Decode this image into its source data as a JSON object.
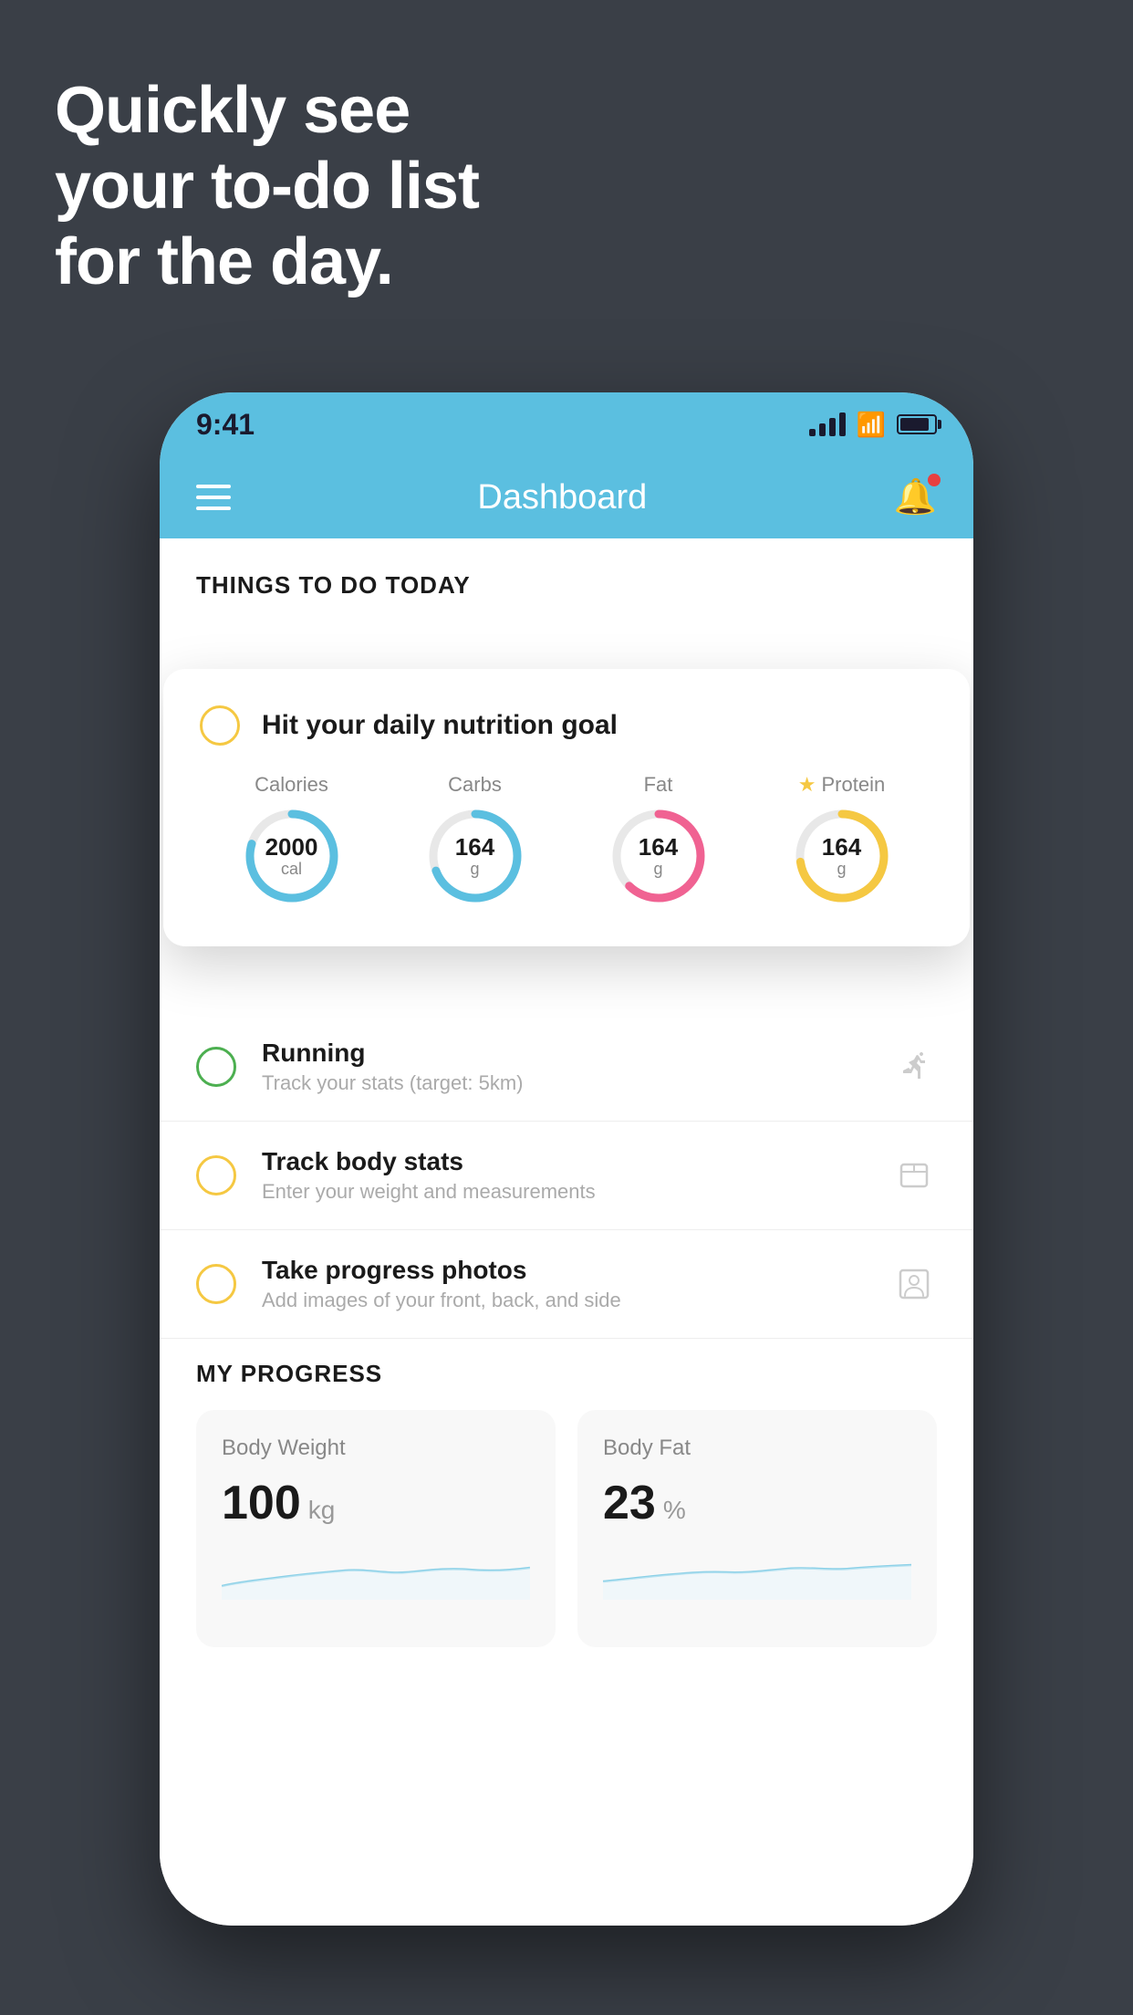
{
  "hero": {
    "line1": "Quickly see",
    "line2": "your to-do list",
    "line3": "for the day."
  },
  "status_bar": {
    "time": "9:41"
  },
  "nav": {
    "title": "Dashboard"
  },
  "things_header": "THINGS TO DO TODAY",
  "floating_card": {
    "task_title": "Hit your daily nutrition goal",
    "labels": [
      "Calories",
      "Carbs",
      "Fat",
      "Protein"
    ],
    "values": [
      "2000 cal",
      "164 g",
      "164 g",
      "164 g"
    ],
    "calories_value": "2000",
    "calories_unit": "cal",
    "carbs_value": "164",
    "carbs_unit": "g",
    "fat_value": "164",
    "fat_unit": "g",
    "protein_value": "164",
    "protein_unit": "g"
  },
  "tasks": [
    {
      "title": "Running",
      "subtitle": "Track your stats (target: 5km)",
      "type": "green"
    },
    {
      "title": "Track body stats",
      "subtitle": "Enter your weight and measurements",
      "type": "yellow"
    },
    {
      "title": "Take progress photos",
      "subtitle": "Add images of your front, back, and side",
      "type": "yellow"
    }
  ],
  "progress": {
    "title": "MY PROGRESS",
    "cards": [
      {
        "title": "Body Weight",
        "value": "100",
        "unit": "kg"
      },
      {
        "title": "Body Fat",
        "value": "23",
        "unit": "%"
      }
    ]
  }
}
